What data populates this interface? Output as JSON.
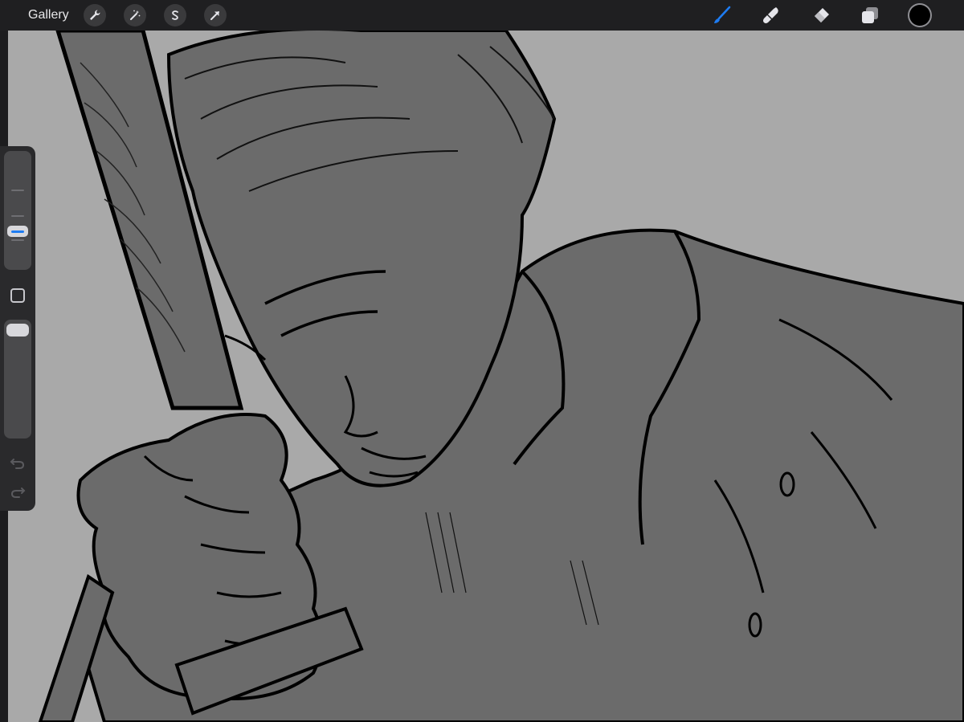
{
  "topbar": {
    "gallery_label": "Gallery",
    "left_tools": [
      {
        "name": "actions",
        "icon": "wrench-icon"
      },
      {
        "name": "adjustments",
        "icon": "magic-wand-icon"
      },
      {
        "name": "selection",
        "icon": "selection-s-icon"
      },
      {
        "name": "transform",
        "icon": "arrow-cursor-icon"
      }
    ],
    "right_tools": [
      {
        "name": "brush",
        "icon": "brush-icon",
        "active": true
      },
      {
        "name": "smudge",
        "icon": "smudge-icon",
        "active": false
      },
      {
        "name": "eraser",
        "icon": "eraser-icon",
        "active": false
      },
      {
        "name": "layers",
        "icon": "layers-icon",
        "active": false
      },
      {
        "name": "color",
        "icon": "color-swatch",
        "active": false
      }
    ]
  },
  "sidebar": {
    "brush_size_level": 0.34,
    "brush_opacity_level": 0.04,
    "modify_button_icon": "square-icon",
    "undo_icon": "undo-icon",
    "redo_icon": "redo-icon"
  },
  "colors": {
    "accent": "#1e7cf2",
    "topbar_bg": "#1f1f21",
    "canvas_bg": "#a9a9a9",
    "figure_fill": "#6b6b6b",
    "current_color": "#000000"
  }
}
